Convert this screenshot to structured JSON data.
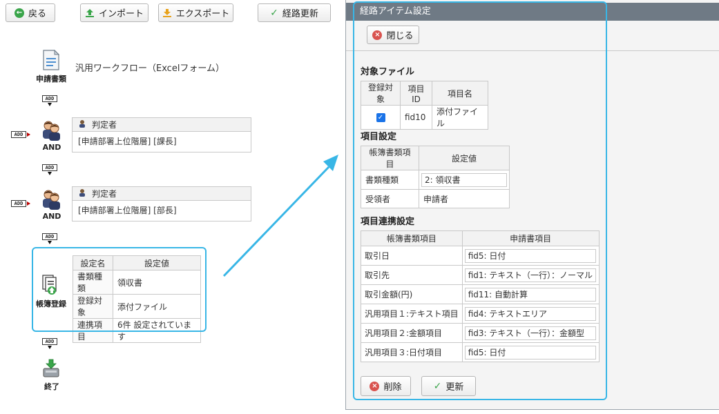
{
  "toolbar": {
    "back_label": "戻る",
    "import_label": "インポート",
    "export_label": "エクスポート",
    "route_update_label": "経路更新"
  },
  "flow": {
    "add_label": "ADD",
    "doc_node": {
      "label": "申請書類",
      "title": "汎用ワークフロー（Excelフォーム）"
    },
    "judges": [
      {
        "group_label": "AND",
        "header": "判定者",
        "value": "[申請部署上位階層] [課長]"
      },
      {
        "group_label": "AND",
        "header": "判定者",
        "value": "[申請部署上位階層] [部長]"
      }
    ],
    "ledger_node": {
      "label": "帳簿登録",
      "headers": [
        "設定名",
        "設定値"
      ],
      "rows": [
        [
          "書類種類",
          "領収書"
        ],
        [
          "登録対象",
          "添付ファイル"
        ],
        [
          "連携項目",
          "6件 設定されています"
        ]
      ]
    },
    "end_node": {
      "label": "終了"
    }
  },
  "panel": {
    "title": "経路アイテム設定",
    "close_label": "閉じる",
    "target_files": {
      "heading": "対象ファイル",
      "headers": [
        "登録対象",
        "項目ID",
        "項目名"
      ],
      "row": {
        "checked": true,
        "id": "fid10",
        "name": "添付ファイル"
      }
    },
    "item_settings": {
      "heading": "項目設定",
      "headers": [
        "帳簿書類項目",
        "設定値"
      ],
      "rows": [
        {
          "label": "書類種類",
          "value": "2: 領収書",
          "input": true
        },
        {
          "label": "受領者",
          "value": "申請者",
          "input": false
        }
      ]
    },
    "link_settings": {
      "heading": "項目連携設定",
      "headers": [
        "帳簿書類項目",
        "申請書項目"
      ],
      "rows": [
        {
          "label": "取引日",
          "value": "fid5: 日付"
        },
        {
          "label": "取引先",
          "value": "fid1: テキスト（一行）：ノーマル"
        },
        {
          "label": "取引金額(円)",
          "value": "fid11: 自動計算"
        },
        {
          "label": "汎用項目１:テキスト項目",
          "value": "fid4: テキストエリア"
        },
        {
          "label": "汎用項目２:金額項目",
          "value": "fid3: テキスト（一行）：金額型"
        },
        {
          "label": "汎用項目３:日付項目",
          "value": "fid5: 日付"
        }
      ]
    },
    "delete_label": "削除",
    "update_label": "更新"
  },
  "colors": {
    "highlight": "#38b6e6",
    "panel_title_bg": "#6f7a85",
    "check_blue": "#1a73e8",
    "delete_red": "#d9534f",
    "update_green": "#3aa54a"
  }
}
